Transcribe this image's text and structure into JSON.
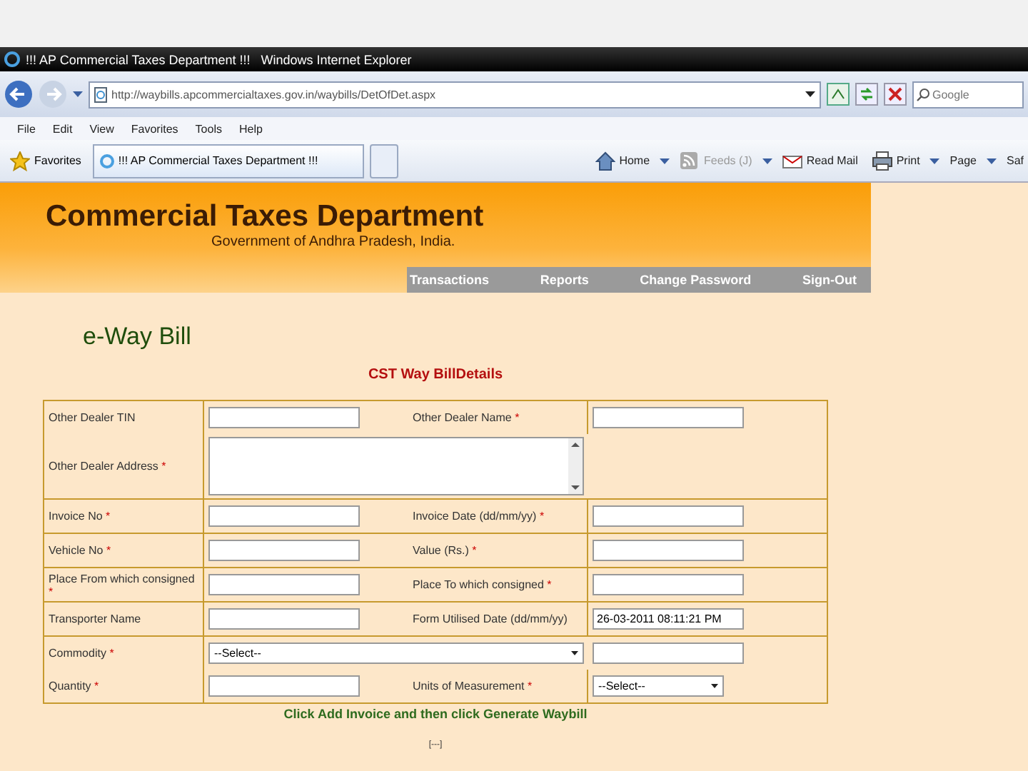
{
  "window": {
    "title": "!!! AP Commercial Taxes Department !!!   Windows Internet Explorer"
  },
  "address_bar": {
    "value": "http://waybills.apcommercialtaxes.gov.in/waybills/DetOfDet.aspx"
  },
  "search": {
    "placeholder": "Google"
  },
  "menu": [
    "File",
    "Edit",
    "View",
    "Favorites",
    "Tools",
    "Help"
  ],
  "favorites": {
    "label": "Favorites"
  },
  "tabs": [
    {
      "label": "!!! AP Commercial Taxes Department !!!",
      "selected": true
    }
  ],
  "command_bar": [
    {
      "kind": "home",
      "label": "Home",
      "disabled": false,
      "dropdown": true
    },
    {
      "kind": "feed",
      "label": "Feeds (J)",
      "disabled": true,
      "dropdown": true
    },
    {
      "kind": "mail",
      "label": "Read Mail",
      "disabled": false,
      "dropdown": false
    },
    {
      "kind": "print",
      "label": "Print",
      "disabled": false,
      "dropdown": true
    },
    {
      "kind": "text",
      "label": "Page",
      "disabled": false,
      "dropdown": true
    },
    {
      "kind": "text",
      "label": "Saf",
      "disabled": false,
      "dropdown": false
    }
  ],
  "site": {
    "title": "Commercial Taxes Department",
    "subtitle": "Government of Andhra Pradesh, India.",
    "nav": [
      "Transactions",
      "Reports",
      "Change Password",
      "Sign-Out"
    ]
  },
  "page_heading": "e-Way Bill",
  "form": {
    "title": "CST Way BillDetails",
    "sections": [
      [
        [
          {
            "kind": "label",
            "text": "Other Dealer TIN"
          },
          {
            "kind": "input"
          },
          {
            "kind": "label",
            "text": "Other Dealer  Name",
            "mark": "*"
          },
          {
            "kind": "input"
          }
        ],
        [
          {
            "kind": "label",
            "text": "Other Dealer  Address",
            "mark": "*"
          },
          {
            "kind": "textarea"
          }
        ]
      ],
      [
        [
          {
            "kind": "label",
            "text": "Invoice No",
            "mark": "*"
          },
          {
            "kind": "input"
          },
          {
            "kind": "label",
            "text": "Invoice Date (dd/mm/yy)",
            "mark": "*"
          },
          {
            "kind": "input"
          }
        ]
      ],
      [
        [
          {
            "kind": "label",
            "text": "Vehicle No",
            "mark": "*"
          },
          {
            "kind": "input"
          },
          {
            "kind": "label",
            "text": "Value (Rs.)",
            "mark": "*"
          },
          {
            "kind": "input"
          }
        ]
      ],
      [
        [
          {
            "kind": "label",
            "text": "Place From which consigned",
            "mark": "*"
          },
          {
            "kind": "input"
          },
          {
            "kind": "label",
            "text": "Place To which consigned",
            "mark": "*"
          },
          {
            "kind": "input"
          }
        ]
      ],
      [
        [
          {
            "kind": "label",
            "text": "Transporter Name"
          },
          {
            "kind": "input"
          },
          {
            "kind": "label",
            "text": "Form Utilised Date (dd/mm/yy)"
          },
          {
            "kind": "input",
            "value": "26-03-2011 08:11:21 PM"
          }
        ]
      ],
      [
        [
          {
            "kind": "label",
            "text": "Commodity",
            "mark": "*"
          },
          {
            "kind": "select",
            "value": "--Select--"
          },
          {
            "kind": "input"
          }
        ],
        [
          {
            "kind": "label",
            "text": "Quantity",
            "mark": "*"
          },
          {
            "kind": "input"
          },
          {
            "kind": "label",
            "text": "Units of Measurement",
            "mark": "*"
          },
          {
            "kind": "select",
            "value": "--Select--"
          }
        ]
      ]
    ],
    "hint": "Click Add Invoice and then click Generate Waybill"
  },
  "footer": "[---]"
}
